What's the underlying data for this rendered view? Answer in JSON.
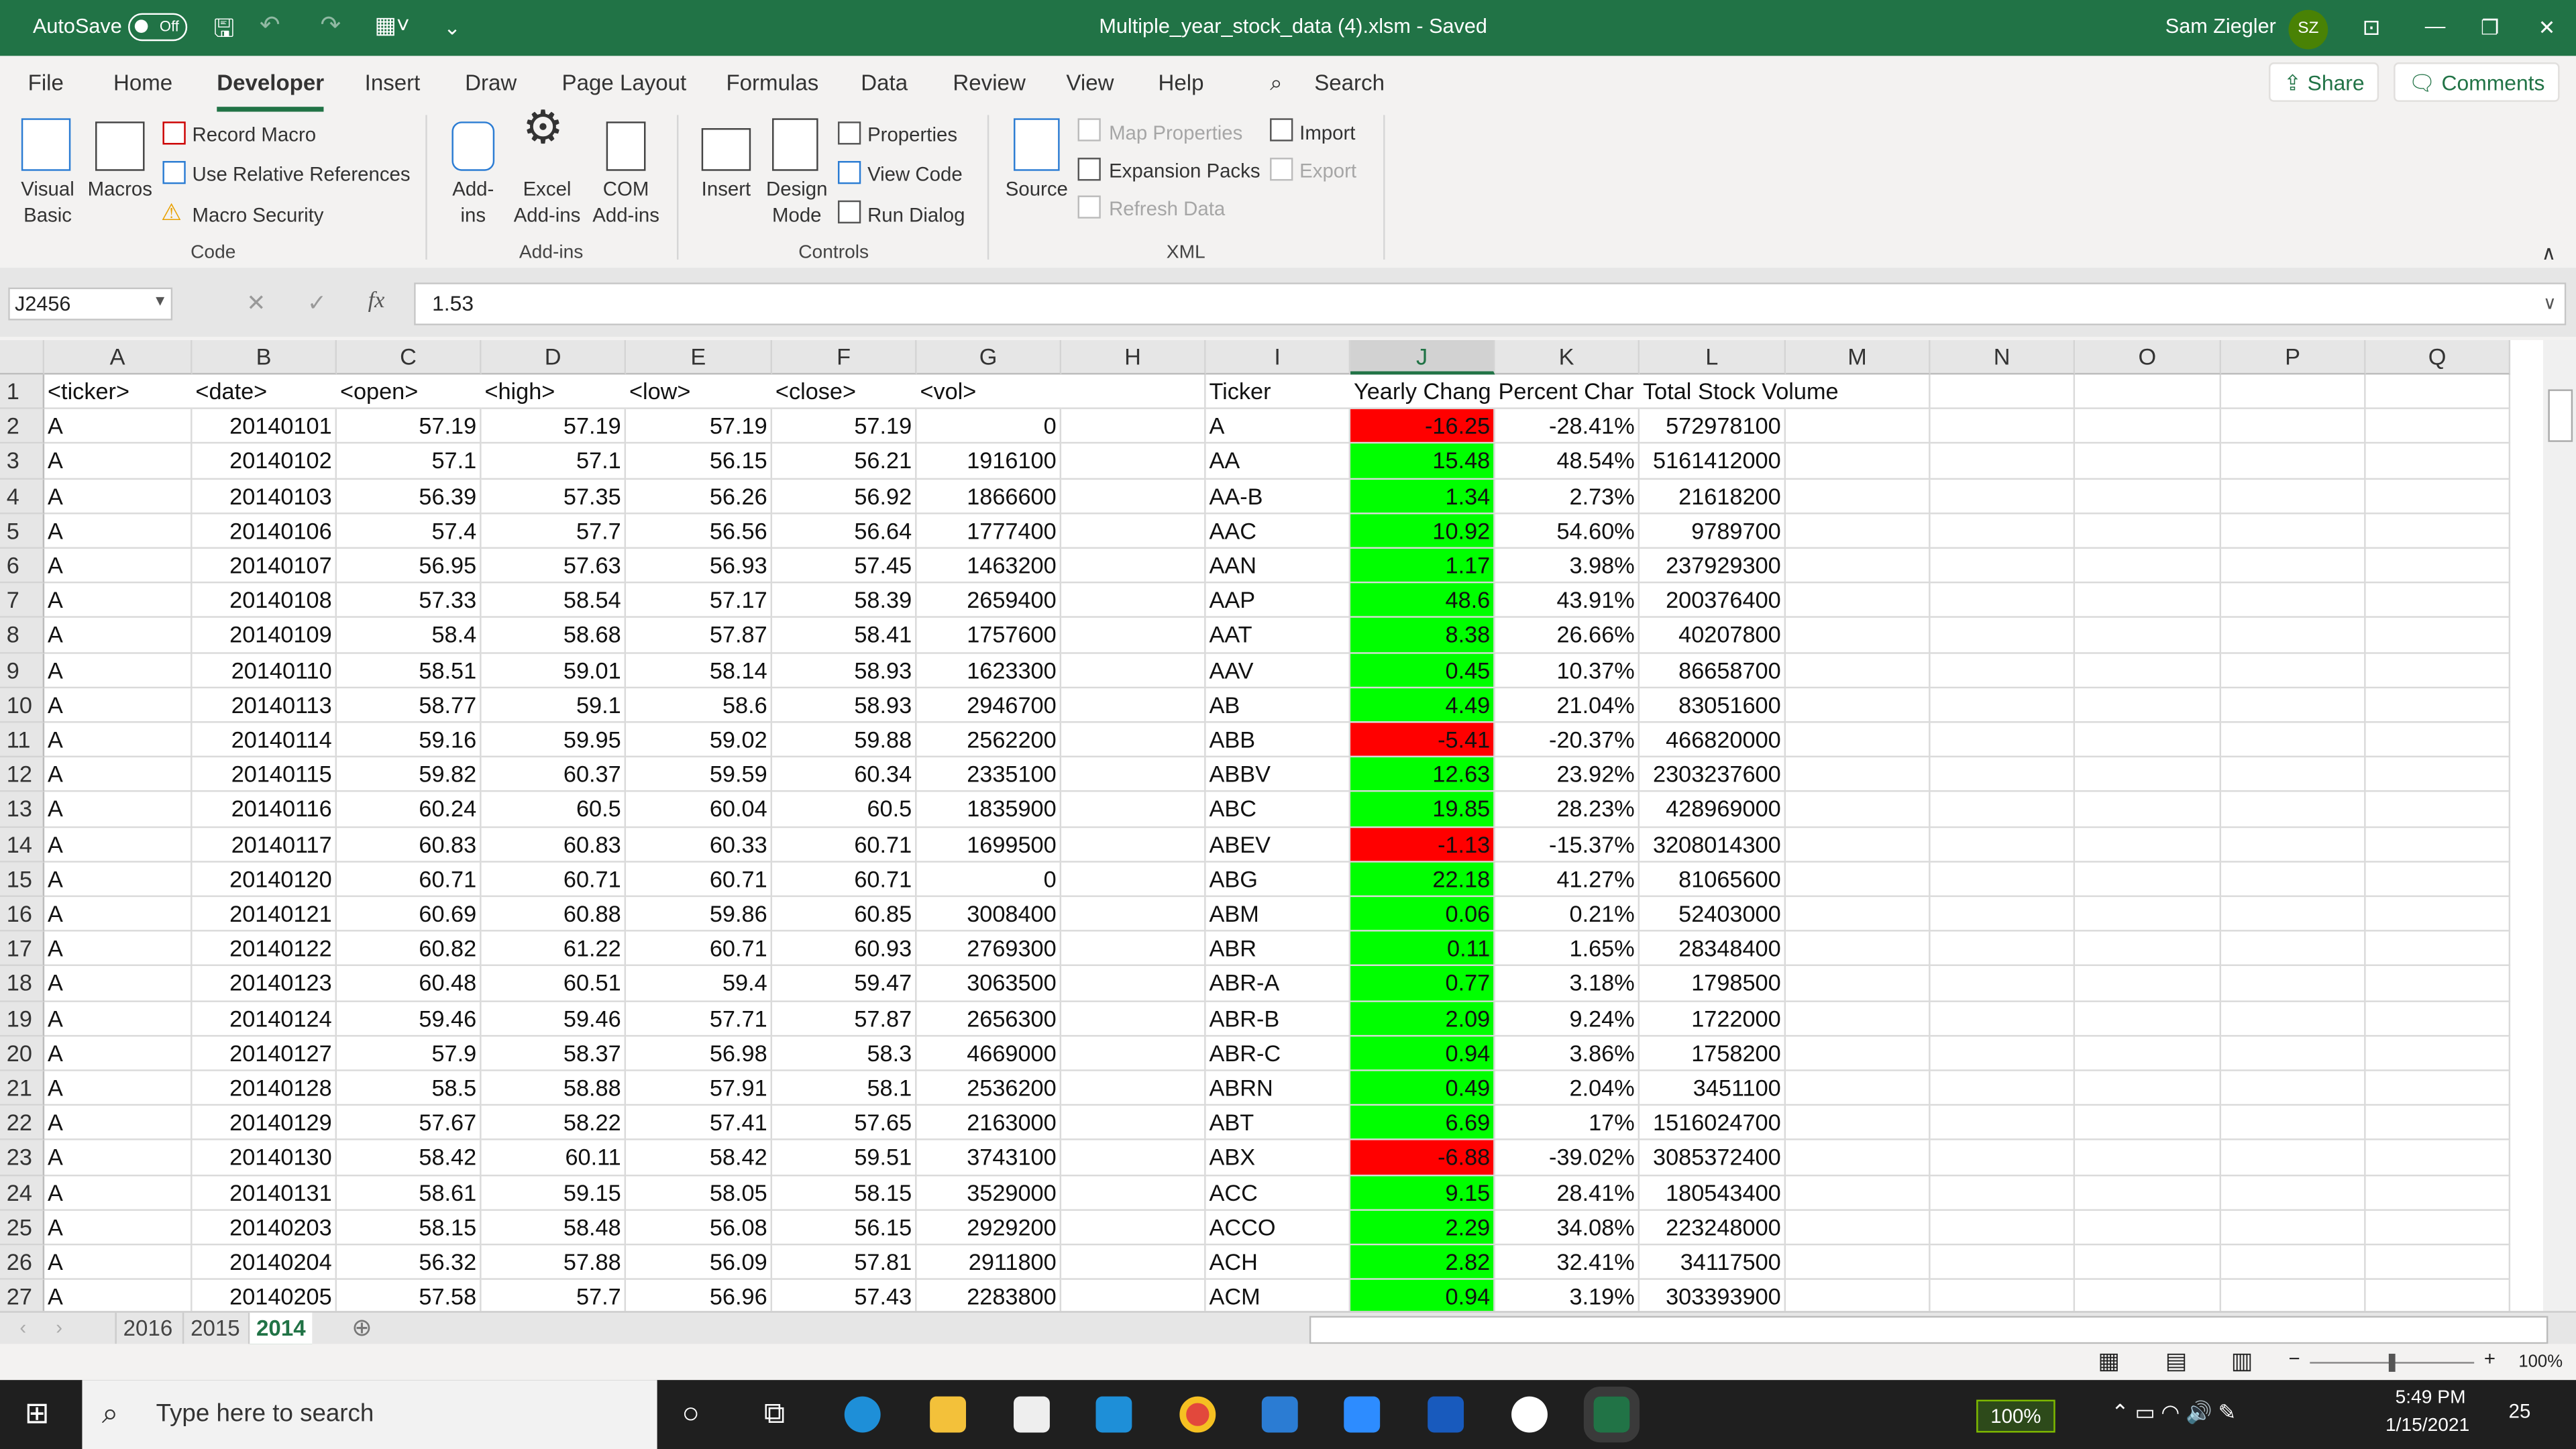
{
  "titlebar": {
    "autosave": "AutoSave",
    "autosave_state": "Off",
    "filename": "Multiple_year_stock_data (4).xlsm  -  Saved",
    "user": "Sam Ziegler",
    "initials": "SZ"
  },
  "menu_tabs": [
    "File",
    "Home",
    "Developer",
    "Insert",
    "Draw",
    "Page Layout",
    "Formulas",
    "Data",
    "Review",
    "View",
    "Help"
  ],
  "active_tab": "Developer",
  "search_label": "Search",
  "share": "Share",
  "comments": "Comments",
  "ribbon": {
    "code": {
      "group": "Code",
      "visual_basic": "Visual Basic",
      "macros": "Macros",
      "record_macro": "Record Macro",
      "relative": "Use Relative References",
      "security": "Macro Security"
    },
    "addins": {
      "group": "Add-ins",
      "addins": "Add-ins",
      "excel_addins": "Excel Add-ins",
      "com_addins": "COM Add-ins"
    },
    "controls": {
      "group": "Controls",
      "insert": "Insert",
      "design_mode": "Design Mode",
      "properties": "Properties",
      "view_code": "View Code",
      "run_dialog": "Run Dialog"
    },
    "xml": {
      "group": "XML",
      "source": "Source",
      "map_properties": "Map Properties",
      "expansion_packs": "Expansion Packs",
      "refresh_data": "Refresh Data",
      "import": "Import",
      "export": "Export"
    }
  },
  "formula_bar": {
    "name_box": "J2456",
    "fx": "fx",
    "value": "1.53"
  },
  "columns": [
    "A",
    "B",
    "C",
    "D",
    "E",
    "F",
    "G",
    "H",
    "I",
    "J",
    "K",
    "L",
    "M",
    "N",
    "O",
    "P",
    "Q"
  ],
  "selected_column": "J",
  "header_row": [
    "<ticker>",
    "<date>",
    "<open>",
    "<high>",
    "<low>",
    "<close>",
    "<vol>",
    "",
    "Ticker",
    "Yearly Chang",
    "Percent Char",
    "Total Stock Volume"
  ],
  "colors": {
    "positive": "#00ff00",
    "negative": "#ff0000",
    "accent": "#217346"
  },
  "rows": [
    [
      "A",
      "20140101",
      "57.19",
      "57.19",
      "57.19",
      "57.19",
      "0",
      "",
      "A",
      "-16.25",
      "-28.41%",
      "572978100"
    ],
    [
      "A",
      "20140102",
      "57.1",
      "57.1",
      "56.15",
      "56.21",
      "1916100",
      "",
      "AA",
      "15.48",
      "48.54%",
      "5161412000"
    ],
    [
      "A",
      "20140103",
      "56.39",
      "57.35",
      "56.26",
      "56.92",
      "1866600",
      "",
      "AA-B",
      "1.34",
      "2.73%",
      "21618200"
    ],
    [
      "A",
      "20140106",
      "57.4",
      "57.7",
      "56.56",
      "56.64",
      "1777400",
      "",
      "AAC",
      "10.92",
      "54.60%",
      "9789700"
    ],
    [
      "A",
      "20140107",
      "56.95",
      "57.63",
      "56.93",
      "57.45",
      "1463200",
      "",
      "AAN",
      "1.17",
      "3.98%",
      "237929300"
    ],
    [
      "A",
      "20140108",
      "57.33",
      "58.54",
      "57.17",
      "58.39",
      "2659400",
      "",
      "AAP",
      "48.6",
      "43.91%",
      "200376400"
    ],
    [
      "A",
      "20140109",
      "58.4",
      "58.68",
      "57.87",
      "58.41",
      "1757600",
      "",
      "AAT",
      "8.38",
      "26.66%",
      "40207800"
    ],
    [
      "A",
      "20140110",
      "58.51",
      "59.01",
      "58.14",
      "58.93",
      "1623300",
      "",
      "AAV",
      "0.45",
      "10.37%",
      "86658700"
    ],
    [
      "A",
      "20140113",
      "58.77",
      "59.1",
      "58.6",
      "58.93",
      "2946700",
      "",
      "AB",
      "4.49",
      "21.04%",
      "83051600"
    ],
    [
      "A",
      "20140114",
      "59.16",
      "59.95",
      "59.02",
      "59.88",
      "2562200",
      "",
      "ABB",
      "-5.41",
      "-20.37%",
      "466820000"
    ],
    [
      "A",
      "20140115",
      "59.82",
      "60.37",
      "59.59",
      "60.34",
      "2335100",
      "",
      "ABBV",
      "12.63",
      "23.92%",
      "2303237600"
    ],
    [
      "A",
      "20140116",
      "60.24",
      "60.5",
      "60.04",
      "60.5",
      "1835900",
      "",
      "ABC",
      "19.85",
      "28.23%",
      "428969000"
    ],
    [
      "A",
      "20140117",
      "60.83",
      "60.83",
      "60.33",
      "60.71",
      "1699500",
      "",
      "ABEV",
      "-1.13",
      "-15.37%",
      "3208014300"
    ],
    [
      "A",
      "20140120",
      "60.71",
      "60.71",
      "60.71",
      "60.71",
      "0",
      "",
      "ABG",
      "22.18",
      "41.27%",
      "81065600"
    ],
    [
      "A",
      "20140121",
      "60.69",
      "60.88",
      "59.86",
      "60.85",
      "3008400",
      "",
      "ABM",
      "0.06",
      "0.21%",
      "52403000"
    ],
    [
      "A",
      "20140122",
      "60.82",
      "61.22",
      "60.71",
      "60.93",
      "2769300",
      "",
      "ABR",
      "0.11",
      "1.65%",
      "28348400"
    ],
    [
      "A",
      "20140123",
      "60.48",
      "60.51",
      "59.4",
      "59.47",
      "3063500",
      "",
      "ABR-A",
      "0.77",
      "3.18%",
      "1798500"
    ],
    [
      "A",
      "20140124",
      "59.46",
      "59.46",
      "57.71",
      "57.87",
      "2656300",
      "",
      "ABR-B",
      "2.09",
      "9.24%",
      "1722000"
    ],
    [
      "A",
      "20140127",
      "57.9",
      "58.37",
      "56.98",
      "58.3",
      "4669000",
      "",
      "ABR-C",
      "0.94",
      "3.86%",
      "1758200"
    ],
    [
      "A",
      "20140128",
      "58.5",
      "58.88",
      "57.91",
      "58.1",
      "2536200",
      "",
      "ABRN",
      "0.49",
      "2.04%",
      "3451100"
    ],
    [
      "A",
      "20140129",
      "57.67",
      "58.22",
      "57.41",
      "57.65",
      "2163000",
      "",
      "ABT",
      "6.69",
      "17%",
      "1516024700"
    ],
    [
      "A",
      "20140130",
      "58.42",
      "60.11",
      "58.42",
      "59.51",
      "3743100",
      "",
      "ABX",
      "-6.88",
      "-39.02%",
      "3085372400"
    ],
    [
      "A",
      "20140131",
      "58.61",
      "59.15",
      "58.05",
      "58.15",
      "3529000",
      "",
      "ACC",
      "9.15",
      "28.41%",
      "180543400"
    ],
    [
      "A",
      "20140203",
      "58.15",
      "58.48",
      "56.08",
      "56.15",
      "2929200",
      "",
      "ACCO",
      "2.29",
      "34.08%",
      "223248000"
    ],
    [
      "A",
      "20140204",
      "56.32",
      "57.88",
      "56.09",
      "57.81",
      "2911800",
      "",
      "ACH",
      "2.82",
      "32.41%",
      "34117500"
    ],
    [
      "A",
      "20140205",
      "57.58",
      "57.7",
      "56.96",
      "57.43",
      "2283800",
      "",
      "ACM",
      "0.94",
      "3.19%",
      "303393900"
    ]
  ],
  "sheets": [
    "2016",
    "2015",
    "2014"
  ],
  "active_sheet": "2014",
  "status": {
    "zoom": "100%"
  },
  "taskbar": {
    "search_placeholder": "Type here to search",
    "battery": "100%",
    "time": "5:49 PM",
    "date": "1/15/2021",
    "notifications": "25"
  }
}
